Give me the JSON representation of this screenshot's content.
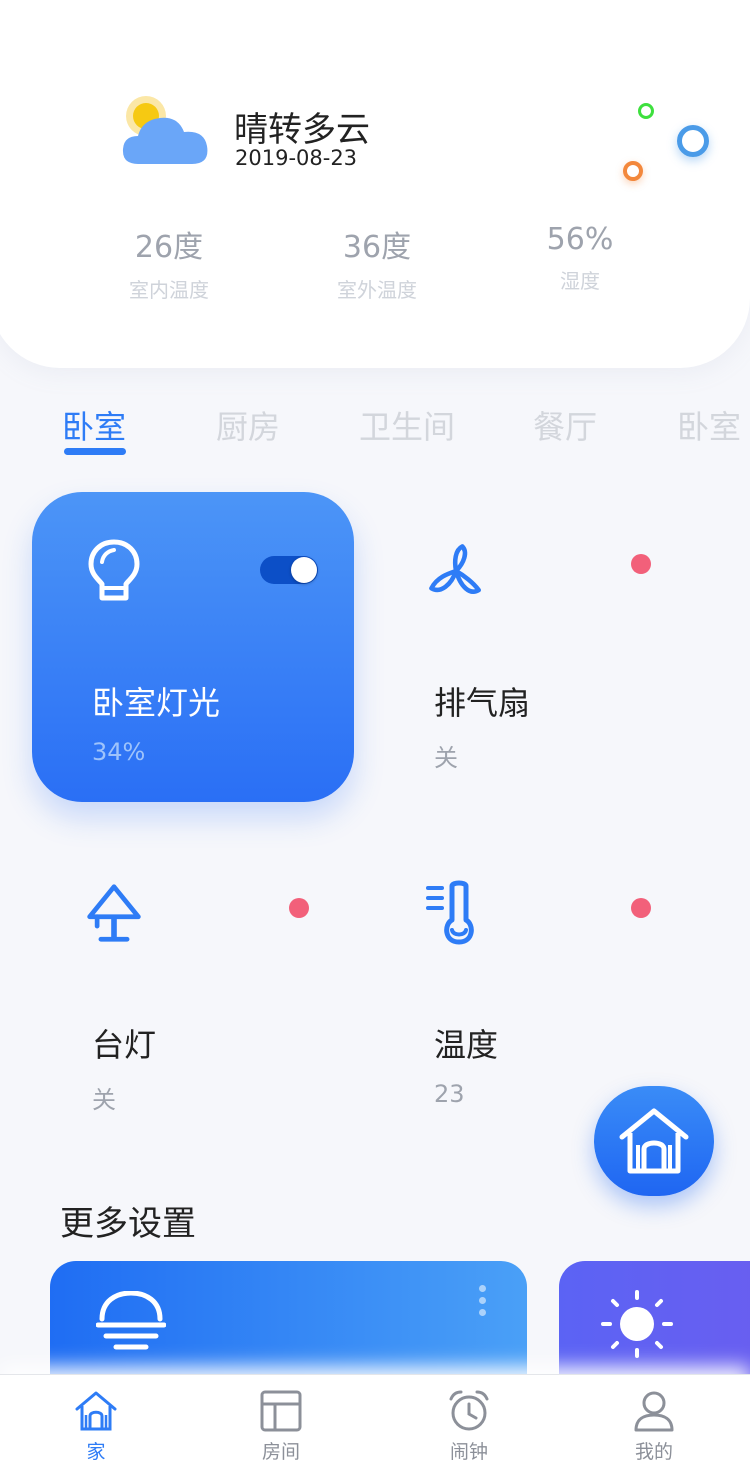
{
  "weather": {
    "condition": "晴转多云",
    "date": "2019-08-23",
    "icon": "partly-cloudy-icon",
    "stats": [
      {
        "value": "26度",
        "label": "室内温度"
      },
      {
        "value": "36度",
        "label": "室外温度"
      },
      {
        "value": "56%",
        "label": "湿度"
      }
    ]
  },
  "tabs": [
    {
      "label": "卧室",
      "active": true
    },
    {
      "label": "厨房",
      "active": false
    },
    {
      "label": "卫生间",
      "active": false
    },
    {
      "label": "餐厅",
      "active": false
    },
    {
      "label": "卧室",
      "active": false
    }
  ],
  "devices": [
    {
      "name": "卧室灯光",
      "status": "34%",
      "icon": "lightbulb-icon",
      "on": true
    },
    {
      "name": "排气扇",
      "status": "关",
      "icon": "fan-icon",
      "on": false
    },
    {
      "name": "台灯",
      "status": "关",
      "icon": "desk-lamp-icon",
      "on": false
    },
    {
      "name": "温度",
      "status": "23",
      "icon": "thermometer-icon",
      "on": false
    }
  ],
  "fab": {
    "icon": "home-icon"
  },
  "more_settings": {
    "title": "更多设置",
    "scenes": [
      {
        "icon": "sunset-icon"
      },
      {
        "icon": "sun-icon"
      }
    ]
  },
  "nav": [
    {
      "label": "家",
      "icon": "home-icon",
      "active": true
    },
    {
      "label": "房间",
      "icon": "layout-icon",
      "active": false
    },
    {
      "label": "闹钟",
      "icon": "alarm-clock-icon",
      "active": false
    },
    {
      "label": "我的",
      "icon": "user-icon",
      "active": false
    }
  ],
  "colors": {
    "accent": "#2e7cf6",
    "status_dot": "#f2607a",
    "purple_card": "#5b63f4"
  }
}
